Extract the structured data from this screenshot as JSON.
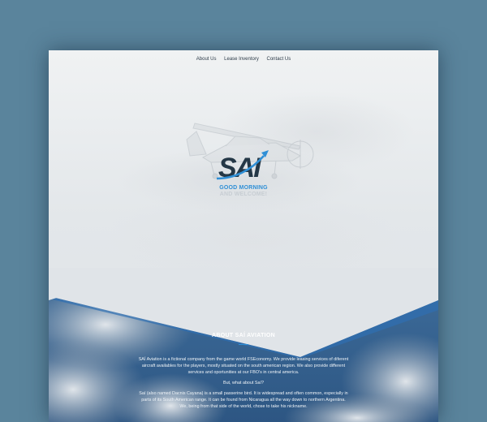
{
  "nav": {
    "items": [
      {
        "label": "About Us"
      },
      {
        "label": "Lease Inventory"
      },
      {
        "label": "Contact Us"
      }
    ]
  },
  "hero": {
    "logo_text": "SAI",
    "greeting_line1": "GOOD MORNING",
    "greeting_line2": "AND WELCOME!"
  },
  "about": {
    "title": "ABOUT SAÍ AVIATION",
    "paragraph1": "SAÍ Aviation is a fictional company from the game world FSEconomy. We provide leasing services of diferent aircraft availables for the players, mostly situated on the south american region. We also provide different services and oportunities at our FBO's in central america.",
    "question": "But, what about Saí?",
    "paragraph2": "Saí (also named Dacnis Cayana) is a small passerine bird. It is widespread and often common, especially in parts of its South American range. It can be found from Nicaragua all the way down to northern Argentina. We, being from that side of the world, chose to take his nickname."
  },
  "colors": {
    "backdrop": "#5a849c",
    "accent": "#2f8fd6",
    "greeting_muted": "#c7cdd3",
    "band_blue": "#3a6fa3"
  }
}
